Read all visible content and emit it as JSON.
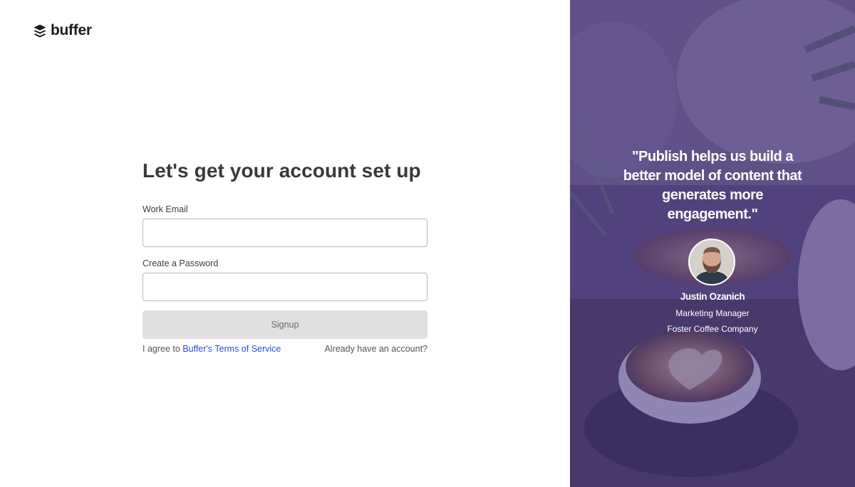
{
  "brand": {
    "logo_text": "buffer"
  },
  "form": {
    "title": "Let's get your account set up",
    "email_label": "Work Email",
    "email_value": "",
    "password_label": "Create a Password",
    "password_value": "",
    "signup_label": "Signup",
    "terms_prefix": "I agree to ",
    "terms_link": "Buffer's Terms of Service",
    "login_link": "Already have an account?"
  },
  "testimonial": {
    "quote": "\"Publish helps us build a better model of content that generates more engagement.\"",
    "name": "Justin Ozanich",
    "role": "Marketing Manager",
    "company": "Foster Coffee Company"
  },
  "icons": {
    "logo": "buffer-stack-icon",
    "avatar": "person-photo"
  },
  "colors": {
    "link": "#2c4bff",
    "signup_bg": "#e0e0e0",
    "panel_tint": "#483a80"
  }
}
